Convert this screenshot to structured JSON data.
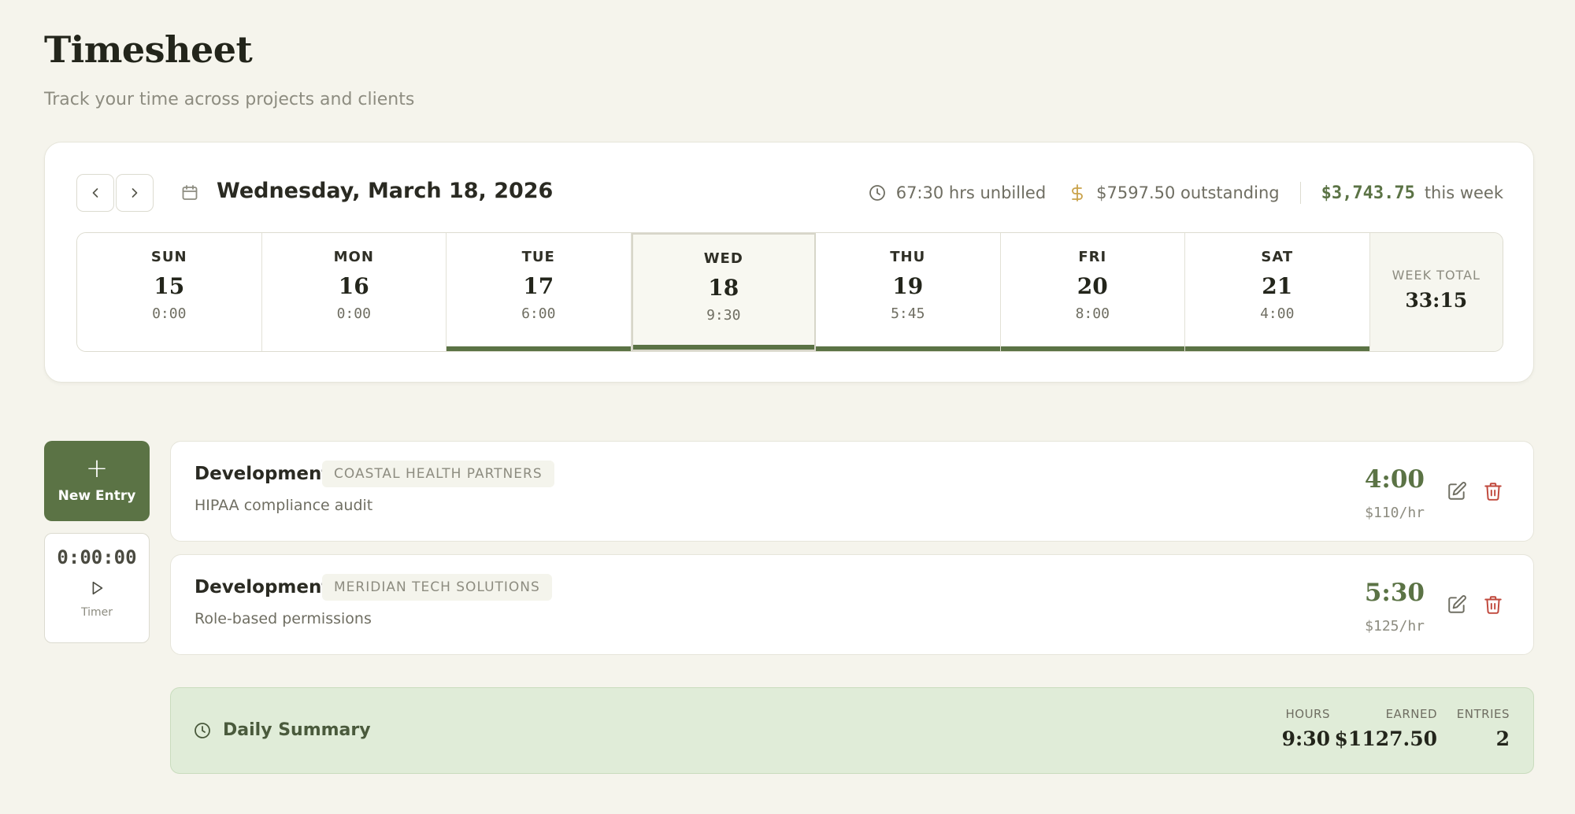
{
  "header": {
    "title": "Timesheet",
    "subtitle": "Track your time across projects and clients"
  },
  "week": {
    "current_date": "Wednesday, March 18, 2026",
    "unbilled": "67:30 hrs unbilled",
    "outstanding": "$7597.50 outstanding",
    "week_amount": "$3,743.75",
    "week_amount_suffix": "this week",
    "days": [
      {
        "name": "SUN",
        "num": "15",
        "hours": "0:00",
        "has_time": false,
        "selected": false
      },
      {
        "name": "MON",
        "num": "16",
        "hours": "0:00",
        "has_time": false,
        "selected": false
      },
      {
        "name": "TUE",
        "num": "17",
        "hours": "6:00",
        "has_time": true,
        "selected": false
      },
      {
        "name": "WED",
        "num": "18",
        "hours": "9:30",
        "has_time": true,
        "selected": true
      },
      {
        "name": "THU",
        "num": "19",
        "hours": "5:45",
        "has_time": true,
        "selected": false
      },
      {
        "name": "FRI",
        "num": "20",
        "hours": "8:00",
        "has_time": true,
        "selected": false
      },
      {
        "name": "SAT",
        "num": "21",
        "hours": "4:00",
        "has_time": true,
        "selected": false
      }
    ],
    "total_label": "WEEK TOTAL",
    "total_value": "33:15"
  },
  "controls": {
    "new_entry_icon": "+",
    "new_entry_label": "New Entry",
    "timer_value": "0:00:00",
    "timer_label": "Timer"
  },
  "entries": [
    {
      "task": "Development",
      "client": "COASTAL HEALTH PARTNERS",
      "description": "HIPAA compliance audit",
      "hours": "4:00",
      "rate": "$110/hr"
    },
    {
      "task": "Development",
      "client": "MERIDIAN TECH SOLUTIONS",
      "description": "Role-based permissions",
      "hours": "5:30",
      "rate": "$125/hr"
    }
  ],
  "summary": {
    "title": "Daily Summary",
    "hours_label": "HOURS",
    "hours_value": "9:30",
    "earned_label": "EARNED",
    "earned_value": "$1127.50",
    "entries_label": "ENTRIES",
    "entries_value": "2"
  },
  "colors": {
    "accent": "#5b7345",
    "danger": "#c0483c",
    "money": "#c9a24a",
    "summary_bg": "#e0ecd8"
  }
}
